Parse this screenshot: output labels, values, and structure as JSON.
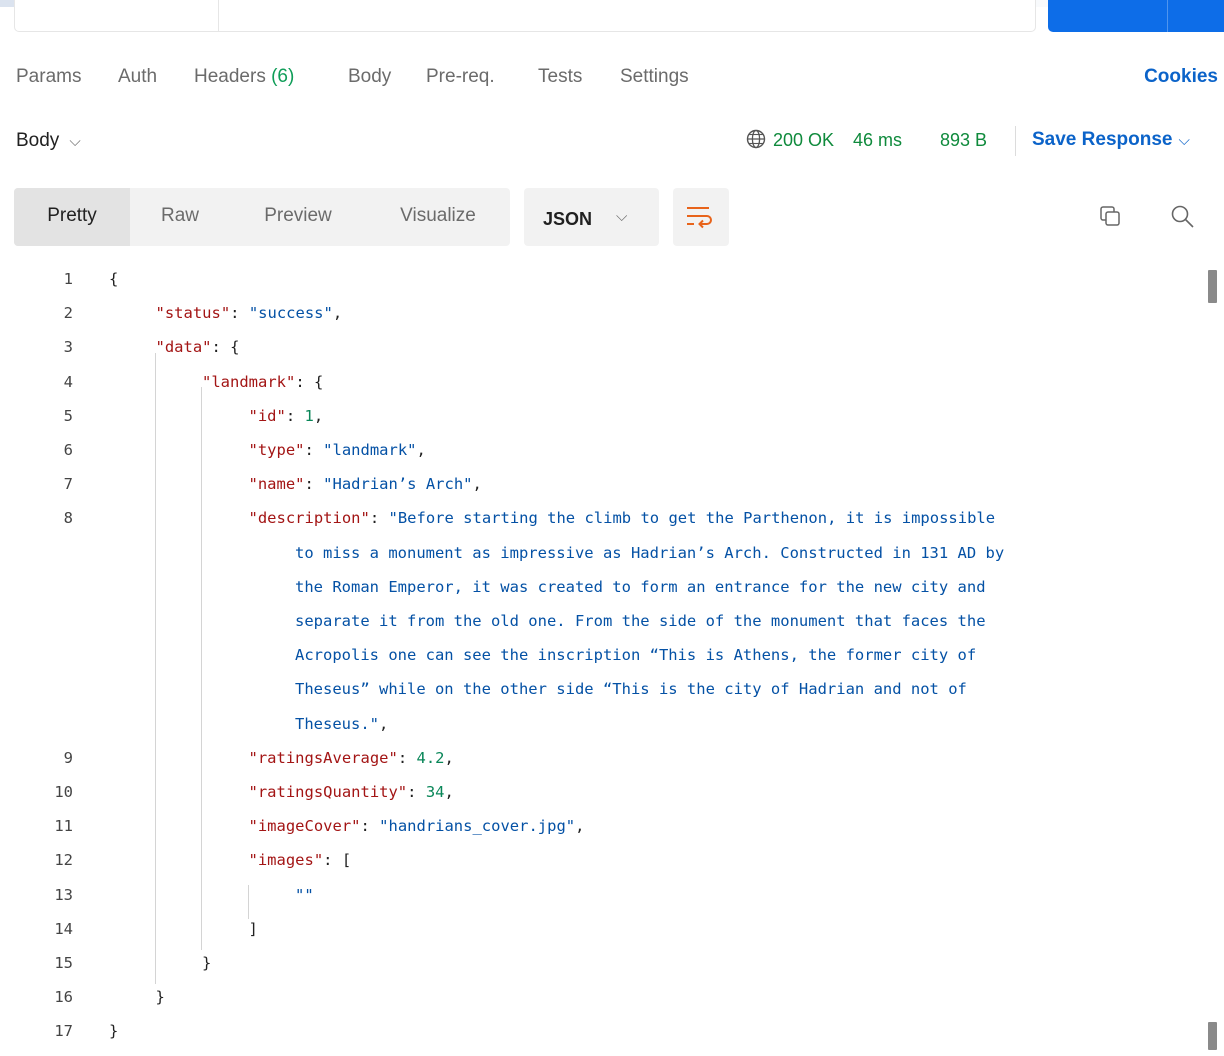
{
  "request_tabs": [
    {
      "label": "Params"
    },
    {
      "label": "Auth"
    },
    {
      "label": "Headers",
      "count": "(6)"
    },
    {
      "label": "Body"
    },
    {
      "label": "Pre-req."
    },
    {
      "label": "Tests"
    },
    {
      "label": "Settings"
    }
  ],
  "cookies_label": "Cookies",
  "response": {
    "body_label": "Body",
    "status": "200 OK",
    "time": "46 ms",
    "size": "893 B",
    "save_label": "Save Response"
  },
  "view_tabs": [
    {
      "label": "Pretty",
      "active": true
    },
    {
      "label": "Raw"
    },
    {
      "label": "Preview"
    },
    {
      "label": "Visualize"
    }
  ],
  "format_label": "JSON",
  "icons": {
    "globe": "globe-icon",
    "wrap": "wrap-lines-icon",
    "copy": "copy-icon",
    "search": "search-icon",
    "chevron": "chevron-down-icon"
  },
  "colors": {
    "accent": "#0b63c9",
    "status_ok": "#0f8a3c",
    "json_key": "#a31515",
    "json_string": "#0451a5",
    "json_number": "#098658"
  },
  "code": {
    "lines": [
      {
        "n": "1",
        "indent": 0,
        "tokens": [
          {
            "t": "p",
            "v": "{"
          }
        ]
      },
      {
        "n": "2",
        "indent": 1,
        "tokens": [
          {
            "t": "k",
            "v": "\"status\""
          },
          {
            "t": "p",
            "v": ": "
          },
          {
            "t": "s",
            "v": "\"success\""
          },
          {
            "t": "p",
            "v": ","
          }
        ]
      },
      {
        "n": "3",
        "indent": 1,
        "tokens": [
          {
            "t": "k",
            "v": "\"data\""
          },
          {
            "t": "p",
            "v": ": {"
          }
        ]
      },
      {
        "n": "4",
        "indent": 2,
        "tokens": [
          {
            "t": "k",
            "v": "\"landmark\""
          },
          {
            "t": "p",
            "v": ": {"
          }
        ]
      },
      {
        "n": "5",
        "indent": 3,
        "tokens": [
          {
            "t": "k",
            "v": "\"id\""
          },
          {
            "t": "p",
            "v": ": "
          },
          {
            "t": "n",
            "v": "1"
          },
          {
            "t": "p",
            "v": ","
          }
        ]
      },
      {
        "n": "6",
        "indent": 3,
        "tokens": [
          {
            "t": "k",
            "v": "\"type\""
          },
          {
            "t": "p",
            "v": ": "
          },
          {
            "t": "s",
            "v": "\"landmark\""
          },
          {
            "t": "p",
            "v": ","
          }
        ]
      },
      {
        "n": "7",
        "indent": 3,
        "tokens": [
          {
            "t": "k",
            "v": "\"name\""
          },
          {
            "t": "p",
            "v": ": "
          },
          {
            "t": "s",
            "v": "\"Hadrian’s Arch\""
          },
          {
            "t": "p",
            "v": ","
          }
        ]
      },
      {
        "n": "8",
        "indent": 3,
        "tokens": [
          {
            "t": "k",
            "v": "\"description\""
          },
          {
            "t": "p",
            "v": ": "
          },
          {
            "t": "s",
            "v": "\"Before starting the climb to get the Parthenon, it is impossible"
          }
        ]
      },
      {
        "n": "",
        "indent": 4,
        "tokens": [
          {
            "t": "s",
            "v": "to miss a monument as impressive as Hadrian’s Arch. Constructed in 131 AD by"
          }
        ]
      },
      {
        "n": "",
        "indent": 4,
        "tokens": [
          {
            "t": "s",
            "v": "the Roman Emperor, it was created to form an entrance for the new city and"
          }
        ]
      },
      {
        "n": "",
        "indent": 4,
        "tokens": [
          {
            "t": "s",
            "v": "separate it from the old one. From the side of the monument that faces the"
          }
        ]
      },
      {
        "n": "",
        "indent": 4,
        "tokens": [
          {
            "t": "s",
            "v": "Acropolis one can see the inscription “This is Athens, the former city of"
          }
        ]
      },
      {
        "n": "",
        "indent": 4,
        "tokens": [
          {
            "t": "s",
            "v": "Theseus” while on the other side “This is the city of Hadrian and not of"
          }
        ]
      },
      {
        "n": "",
        "indent": 4,
        "tokens": [
          {
            "t": "s",
            "v": "Theseus.\""
          },
          {
            "t": "p",
            "v": ","
          }
        ]
      },
      {
        "n": "9",
        "indent": 3,
        "tokens": [
          {
            "t": "k",
            "v": "\"ratingsAverage\""
          },
          {
            "t": "p",
            "v": ": "
          },
          {
            "t": "n",
            "v": "4.2"
          },
          {
            "t": "p",
            "v": ","
          }
        ]
      },
      {
        "n": "10",
        "indent": 3,
        "tokens": [
          {
            "t": "k",
            "v": "\"ratingsQuantity\""
          },
          {
            "t": "p",
            "v": ": "
          },
          {
            "t": "n",
            "v": "34"
          },
          {
            "t": "p",
            "v": ","
          }
        ]
      },
      {
        "n": "11",
        "indent": 3,
        "tokens": [
          {
            "t": "k",
            "v": "\"imageCover\""
          },
          {
            "t": "p",
            "v": ": "
          },
          {
            "t": "s",
            "v": "\"handrians_cover.jpg\""
          },
          {
            "t": "p",
            "v": ","
          }
        ]
      },
      {
        "n": "12",
        "indent": 3,
        "tokens": [
          {
            "t": "k",
            "v": "\"images\""
          },
          {
            "t": "p",
            "v": ": ["
          }
        ]
      },
      {
        "n": "13",
        "indent": 4,
        "tokens": [
          {
            "t": "s",
            "v": "\"\""
          }
        ]
      },
      {
        "n": "14",
        "indent": 3,
        "tokens": [
          {
            "t": "p",
            "v": "]"
          }
        ]
      },
      {
        "n": "15",
        "indent": 2,
        "tokens": [
          {
            "t": "p",
            "v": "}"
          }
        ]
      },
      {
        "n": "16",
        "indent": 1,
        "tokens": [
          {
            "t": "p",
            "v": "}"
          }
        ]
      },
      {
        "n": "17",
        "indent": 0,
        "tokens": [
          {
            "t": "p",
            "v": "}"
          }
        ]
      }
    ]
  }
}
